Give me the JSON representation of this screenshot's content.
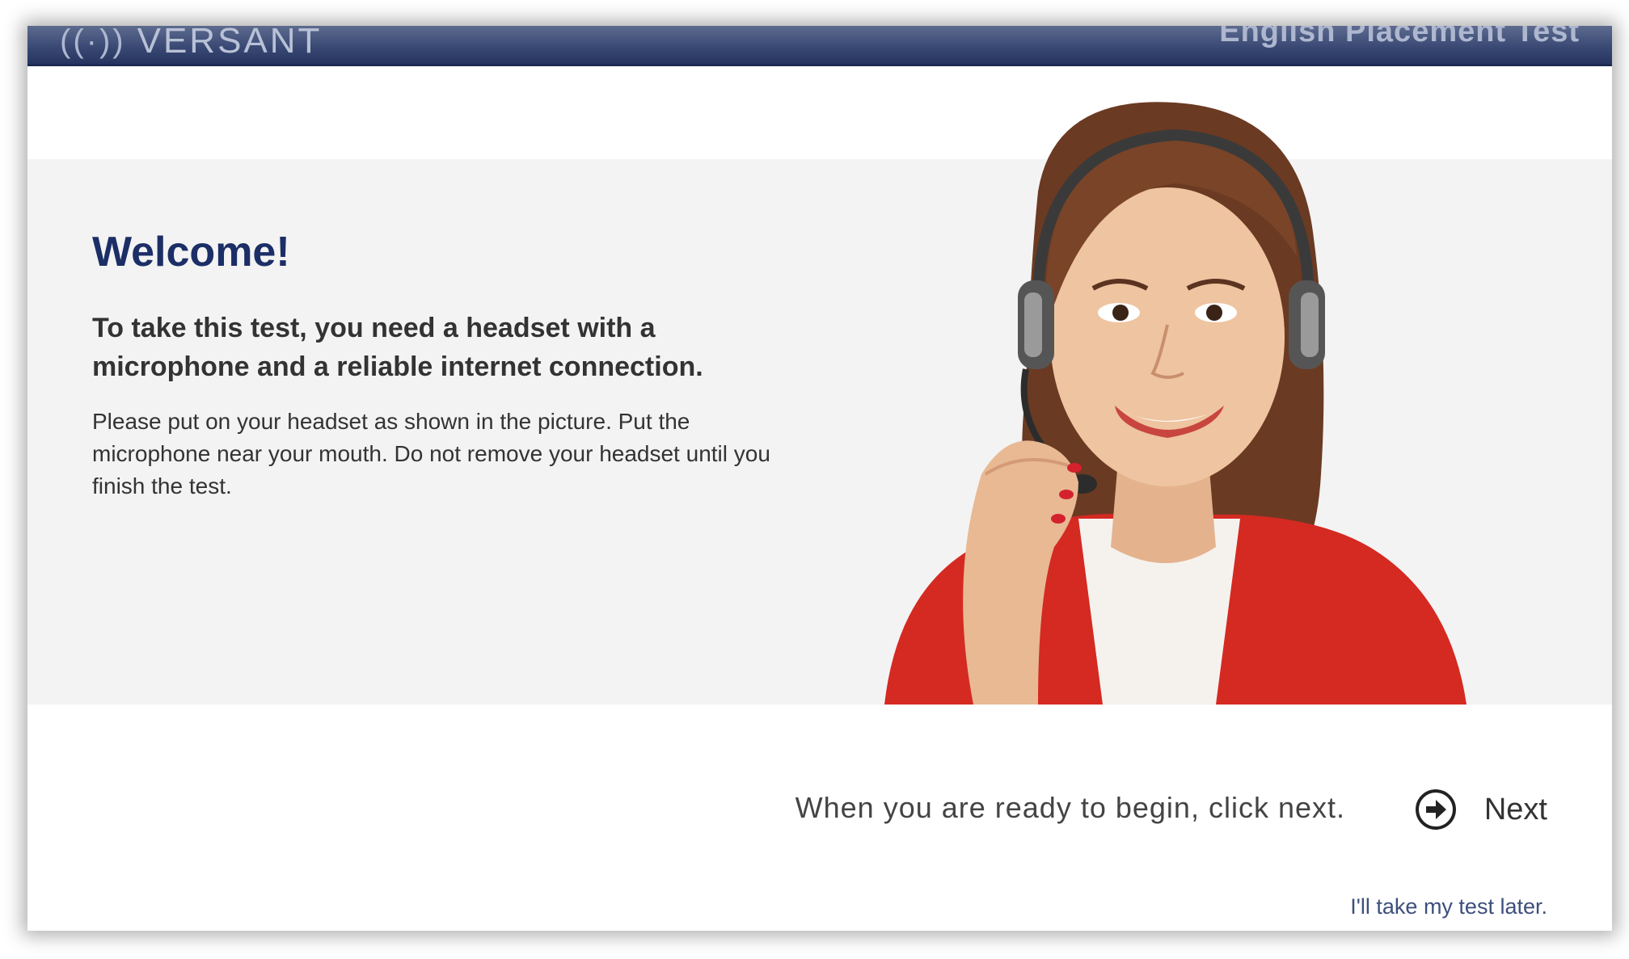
{
  "header": {
    "brand": "VERSANT",
    "title": "English Placement Test"
  },
  "main": {
    "heading": "Welcome!",
    "intro": "To take this test, you need a headset with a microphone and a reliable internet connection.",
    "instructions": "Please put on your headset as shown in the picture. Put the microphone near your mouth. Do not remove your headset until you finish the test."
  },
  "footer": {
    "ready_text": "When you are ready to begin, click next.",
    "next_label": "Next",
    "later_link": "I'll take my test later."
  },
  "icons": {
    "brand": "sound-wave-icon",
    "next": "arrow-right-circle-icon"
  },
  "colors": {
    "header_bar": "#2c3b66",
    "heading": "#1c2e66",
    "band": "#f3f3f3",
    "link": "#3d4f7c"
  }
}
